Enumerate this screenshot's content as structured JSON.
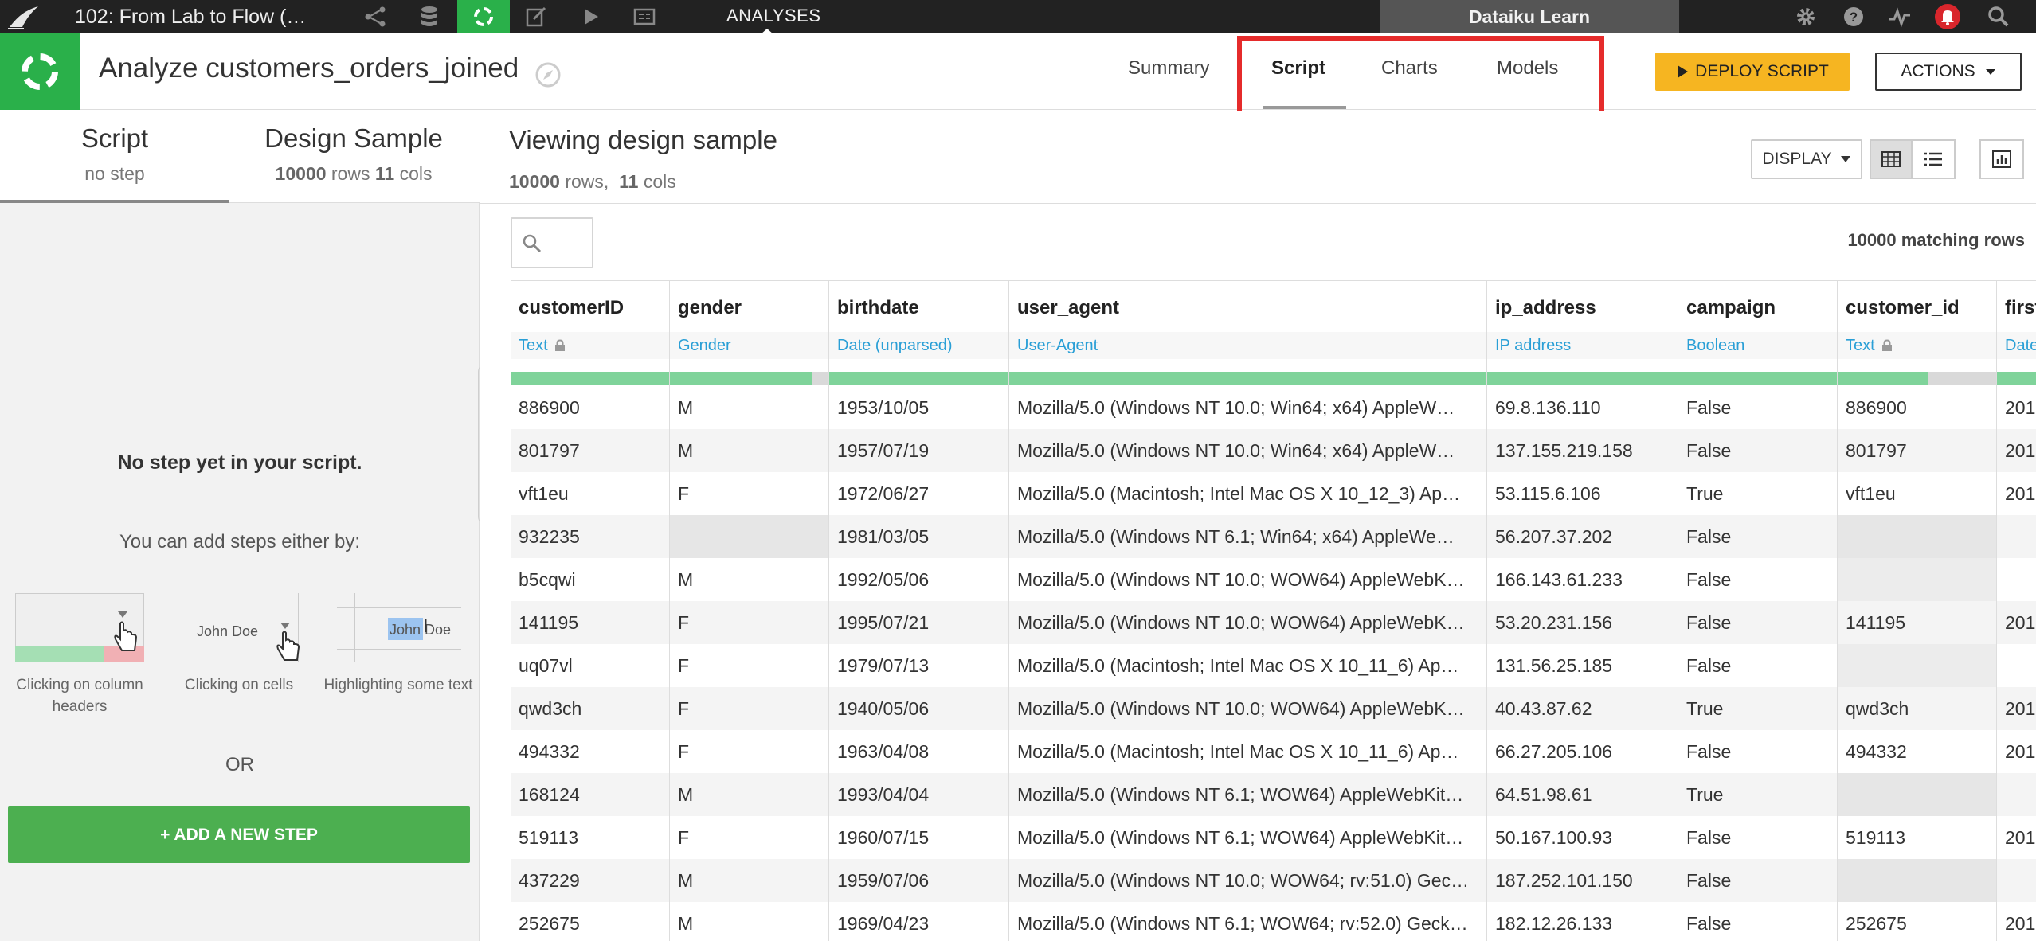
{
  "topbar": {
    "project_title": "102: From Lab to Flow (…",
    "section": "ANALYSES",
    "instance": "Dataiku Learn"
  },
  "header": {
    "title": "Analyze customers_orders_joined",
    "tabs": [
      "Summary",
      "Script",
      "Charts",
      "Models"
    ],
    "active_tab": "Script",
    "deploy_label": "DEPLOY SCRIPT",
    "actions_label": "ACTIONS"
  },
  "left": {
    "tab_script": {
      "name": "Script",
      "sub": "no step"
    },
    "tab_sample": {
      "name": "Design Sample",
      "rows": "10000",
      "rows_label": "rows",
      "cols": "11",
      "cols_label": "cols"
    },
    "empty_title": "No step yet in your script.",
    "empty_sub": "You can add steps either by:",
    "hints": [
      {
        "caption": "Clicking on column headers"
      },
      {
        "caption": "Clicking on cells",
        "sample": "John Doe"
      },
      {
        "caption": "Highlighting some text",
        "sample": "John Doe"
      }
    ],
    "or": "OR",
    "add_step": "+ ADD A NEW STEP"
  },
  "main": {
    "title": "Viewing design sample",
    "rows": "10000",
    "rows_label": "rows,",
    "cols": "11",
    "cols_label": "cols",
    "display_label": "DISPLAY",
    "matching": "10000 matching rows"
  },
  "table": {
    "columns": [
      {
        "name": "customerID",
        "meaning": "Text",
        "locked": true,
        "quality": 1.0
      },
      {
        "name": "gender",
        "meaning": "Gender",
        "locked": false,
        "quality": 0.9
      },
      {
        "name": "birthdate",
        "meaning": "Date (unparsed)",
        "locked": false,
        "quality": 1.0
      },
      {
        "name": "user_agent",
        "meaning": "User-Agent",
        "locked": false,
        "quality": 1.0
      },
      {
        "name": "ip_address",
        "meaning": "IP address",
        "locked": false,
        "quality": 1.0
      },
      {
        "name": "campaign",
        "meaning": "Boolean",
        "locked": false,
        "quality": 1.0
      },
      {
        "name": "customer_id",
        "meaning": "Text",
        "locked": true,
        "quality": 0.57
      },
      {
        "name": "first_order_date",
        "meaning": "Date",
        "locked": false,
        "quality": 0.6
      }
    ],
    "rows": [
      [
        "886900",
        "M",
        "1953/10/05",
        "Mozilla/5.0 (Windows NT 10.0; Win64; x64) AppleW…",
        "69.8.136.110",
        "False",
        "886900",
        "201"
      ],
      [
        "801797",
        "M",
        "1957/07/19",
        "Mozilla/5.0 (Windows NT 10.0; Win64; x64) AppleW…",
        "137.155.219.158",
        "False",
        "801797",
        "201"
      ],
      [
        "vft1eu",
        "F",
        "1972/06/27",
        "Mozilla/5.0 (Macintosh; Intel Mac OS X 10_12_3) Ap…",
        "53.115.6.106",
        "True",
        "vft1eu",
        "201"
      ],
      [
        "932235",
        "",
        "1981/03/05",
        "Mozilla/5.0 (Windows NT 6.1; Win64; x64) AppleWe…",
        "56.207.37.202",
        "False",
        "",
        ""
      ],
      [
        "b5cqwi",
        "M",
        "1992/05/06",
        "Mozilla/5.0 (Windows NT 10.0; WOW64) AppleWebK…",
        "166.143.61.233",
        "False",
        "",
        ""
      ],
      [
        "141195",
        "F",
        "1995/07/21",
        "Mozilla/5.0 (Windows NT 10.0; WOW64) AppleWebK…",
        "53.20.231.156",
        "False",
        "141195",
        "201"
      ],
      [
        "uq07vl",
        "F",
        "1979/07/13",
        "Mozilla/5.0 (Macintosh; Intel Mac OS X 10_11_6) Ap…",
        "131.56.25.185",
        "False",
        "",
        ""
      ],
      [
        "qwd3ch",
        "F",
        "1940/05/06",
        "Mozilla/5.0 (Windows NT 10.0; WOW64) AppleWebK…",
        "40.43.87.62",
        "True",
        "qwd3ch",
        "201"
      ],
      [
        "494332",
        "F",
        "1963/04/08",
        "Mozilla/5.0 (Macintosh; Intel Mac OS X 10_11_6) Ap…",
        "66.27.205.106",
        "False",
        "494332",
        "201"
      ],
      [
        "168124",
        "M",
        "1993/04/04",
        "Mozilla/5.0 (Windows NT 6.1; WOW64) AppleWebKit…",
        "64.51.98.61",
        "True",
        "",
        ""
      ],
      [
        "519113",
        "F",
        "1960/07/15",
        "Mozilla/5.0 (Windows NT 6.1; WOW64) AppleWebKit…",
        "50.167.100.93",
        "False",
        "519113",
        "201"
      ],
      [
        "437229",
        "M",
        "1959/07/06",
        "Mozilla/5.0 (Windows NT 10.0; WOW64; rv:51.0) Gec…",
        "187.252.101.150",
        "False",
        "",
        ""
      ],
      [
        "252675",
        "M",
        "1969/04/23",
        "Mozilla/5.0 (Windows NT 6.1; WOW64; rv:52.0) Geck…",
        "182.12.26.133",
        "False",
        "252675",
        "201"
      ]
    ]
  },
  "colors": {
    "accent_green": "#2ab04a",
    "deploy_yellow": "#f6b521",
    "highlight_red": "#e52b2b",
    "meaning_blue": "#2a9fd6"
  }
}
